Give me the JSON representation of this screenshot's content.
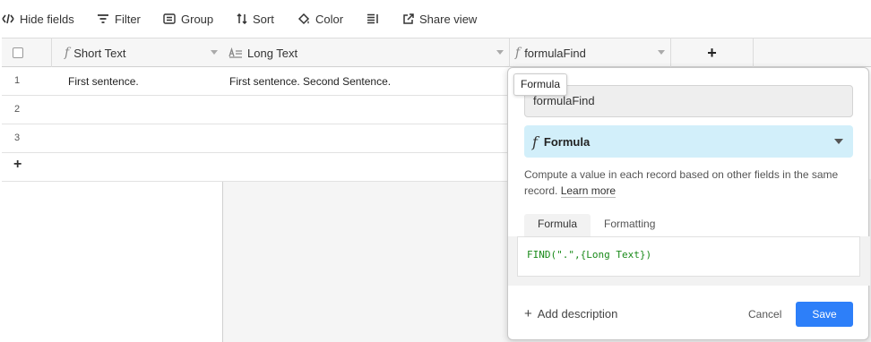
{
  "toolbar": {
    "hide_fields": "Hide fields",
    "filter": "Filter",
    "group": "Group",
    "sort": "Sort",
    "color": "Color",
    "share_view": "Share view"
  },
  "columns": [
    {
      "label": "Short Text",
      "icon": "formula-icon"
    },
    {
      "label": "Long Text",
      "icon": "long-text-icon"
    },
    {
      "label": "formulaFind",
      "icon": "formula-icon"
    }
  ],
  "add_column": "+",
  "rows": [
    {
      "num": "1",
      "short_text": "First sentence.",
      "long_text": "First sentence. Second Sentence."
    },
    {
      "num": "2",
      "short_text": "",
      "long_text": ""
    },
    {
      "num": "3",
      "short_text": "",
      "long_text": ""
    }
  ],
  "add_row": "+",
  "popover": {
    "tooltip": "Formula",
    "field_name": "formulaFind",
    "field_type": "Formula",
    "description": "Compute a value in each record based on other fields in the same record.",
    "learn_more": "Learn more",
    "tabs": [
      "Formula",
      "Formatting"
    ],
    "formula": "FIND(\".\",{Long Text})",
    "add_description": "Add description",
    "cancel": "Cancel",
    "save": "Save"
  },
  "colors": {
    "accent": "#2d7ff9",
    "type_bg": "#d2effa",
    "formula_text": "#1a8a1a"
  }
}
